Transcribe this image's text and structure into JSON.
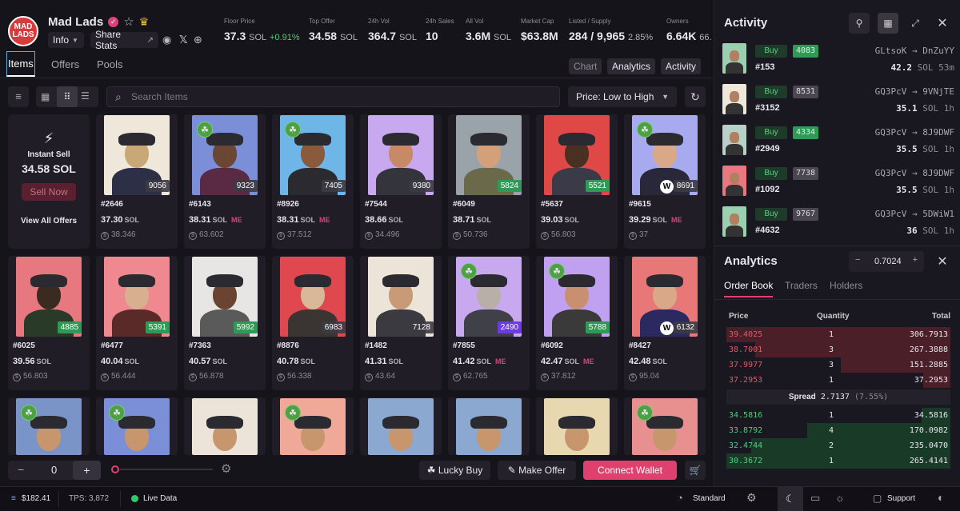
{
  "header": {
    "collection_name": "Mad Lads",
    "logo_text": "MAD LADS",
    "info_label": "Info",
    "share_stats_label": "Share Stats"
  },
  "stats": [
    {
      "label": "Floor Price",
      "value": "37.3",
      "unit": "SOL",
      "change": "+0.91%"
    },
    {
      "label": "Top Offer",
      "value": "34.58",
      "unit": "SOL",
      "change": ""
    },
    {
      "label": "24h Vol",
      "value": "364.7",
      "unit": "SOL",
      "change": ""
    },
    {
      "label": "24h Sales",
      "value": "10",
      "unit": "",
      "change": ""
    },
    {
      "label": "All Vol",
      "value": "3.6M",
      "unit": "SOL",
      "change": ""
    },
    {
      "label": "Market Cap",
      "value": "$63.8M",
      "unit": "",
      "change": ""
    },
    {
      "label": "Listed / Supply",
      "value": "284 / 9,965",
      "unit": "",
      "change": "2.85%"
    },
    {
      "label": "Owners",
      "value": "6.64K",
      "unit": "66.",
      "change": ""
    }
  ],
  "tabs": {
    "items": "Items",
    "offers": "Offers",
    "pools": "Pools",
    "chart": "Chart",
    "analytics": "Analytics",
    "activity": "Activity"
  },
  "toolbar": {
    "search_placeholder": "Search Items",
    "sort_label": "Price: Low to High"
  },
  "instant_sell": {
    "title": "Instant Sell",
    "price": "34.58 SOL",
    "sell_now": "Sell Now",
    "view_all": "View All Offers"
  },
  "cards": [
    {
      "name": "#2646",
      "price": "37.30",
      "last": "38.346",
      "rank": "9056",
      "me": false,
      "clover": false
    },
    {
      "name": "#6143",
      "price": "38.31",
      "last": "63.602",
      "rank": "9323",
      "me": true,
      "clover": true
    },
    {
      "name": "#8926",
      "price": "38.31",
      "last": "37.512",
      "rank": "7405",
      "me": true,
      "clover": true
    },
    {
      "name": "#7544",
      "price": "38.66",
      "last": "34.496",
      "rank": "9380",
      "me": false,
      "clover": false
    },
    {
      "name": "#6049",
      "price": "38.71",
      "last": "50.736",
      "rank": "5824",
      "me": false,
      "clover": false
    },
    {
      "name": "#5637",
      "price": "39.03",
      "last": "56.803",
      "rank": "5521",
      "me": false,
      "clover": false
    },
    {
      "name": "#9615",
      "price": "39.29",
      "last": "37",
      "rank": "8691",
      "me": true,
      "clover": true
    },
    {
      "name": "#6025",
      "price": "39.56",
      "last": "56.803",
      "rank": "4885",
      "me": false,
      "clover": false
    },
    {
      "name": "#6477",
      "price": "40.04",
      "last": "56.444",
      "rank": "5391",
      "me": false,
      "clover": false
    },
    {
      "name": "#7363",
      "price": "40.57",
      "last": "56.878",
      "rank": "5992",
      "me": false,
      "clover": false
    },
    {
      "name": "#8876",
      "price": "40.78",
      "last": "56.338",
      "rank": "6983",
      "me": false,
      "clover": false
    },
    {
      "name": "#1482",
      "price": "41.31",
      "last": "43.64",
      "rank": "7128",
      "me": false,
      "clover": false
    },
    {
      "name": "#7855",
      "price": "41.42",
      "last": "62.765",
      "rank": "2490",
      "me": true,
      "clover": true
    },
    {
      "name": "#6092",
      "price": "42.47",
      "last": "37.812",
      "rank": "5788",
      "me": true,
      "clover": true
    },
    {
      "name": "#8427",
      "price": "42.48",
      "last": "95.04",
      "rank": "6132",
      "me": false,
      "clover": false
    }
  ],
  "card_unit": "SOL",
  "me_mark": "ME",
  "bottom": {
    "quantity": "0",
    "lucky_buy": "Lucky Buy",
    "make_offer": "Make Offer",
    "connect_wallet": "Connect Wallet"
  },
  "activity": {
    "title": "Activity",
    "rows": [
      {
        "type": "Buy",
        "rank": "4083",
        "num": "#153",
        "from": "GLtsoK",
        "to": "DnZuYY",
        "price": "42.2",
        "unit": "SOL",
        "time": "53m"
      },
      {
        "type": "Buy",
        "rank": "8531",
        "num": "#3152",
        "from": "GQ3PcV",
        "to": "9VNjTE",
        "price": "35.1",
        "unit": "SOL",
        "time": "1h"
      },
      {
        "type": "Buy",
        "rank": "4334",
        "num": "#2949",
        "from": "GQ3PcV",
        "to": "8J9DWF",
        "price": "35.5",
        "unit": "SOL",
        "time": "1h"
      },
      {
        "type": "Buy",
        "rank": "7738",
        "num": "#1092",
        "from": "GQ3PcV",
        "to": "8J9DWF",
        "price": "35.5",
        "unit": "SOL",
        "time": "1h"
      },
      {
        "type": "Buy",
        "rank": "9767",
        "num": "#4632",
        "from": "GQ3PcV",
        "to": "5DWiW1",
        "price": "36",
        "unit": "SOL",
        "time": "1h"
      }
    ]
  },
  "analytics": {
    "title": "Analytics",
    "step_value": "0.7024",
    "tabs": [
      "Order Book",
      "Traders",
      "Holders"
    ],
    "headers": {
      "price": "Price",
      "quantity": "Quantity",
      "total": "Total"
    },
    "asks": [
      {
        "price": "39.4025",
        "qty": "1",
        "total": "306.7913",
        "fill": 1.0
      },
      {
        "price": "38.7001",
        "qty": "3",
        "total": "267.3888",
        "fill": 0.87
      },
      {
        "price": "37.9977",
        "qty": "3",
        "total": "151.2885",
        "fill": 0.49
      },
      {
        "price": "37.2953",
        "qty": "1",
        "total": "37.2953",
        "fill": 0.12
      }
    ],
    "spread_label": "Spread",
    "spread_value": "2.7137",
    "spread_pct": "(7.55%)",
    "bids": [
      {
        "price": "34.5816",
        "qty": "1",
        "total": "34.5816",
        "fill": 0.13
      },
      {
        "price": "33.8792",
        "qty": "4",
        "total": "170.0982",
        "fill": 0.64
      },
      {
        "price": "32.4744",
        "qty": "2",
        "total": "235.0470",
        "fill": 0.89
      },
      {
        "price": "30.3672",
        "qty": "1",
        "total": "265.4141",
        "fill": 1.0
      }
    ]
  },
  "status": {
    "sol_price": "$182.41",
    "tps": "TPS: 3,872",
    "live": "Live Data",
    "mode": "Standard",
    "support": "Support"
  },
  "colors": {
    "accent_pink": "#e0406e",
    "green": "#4cd07d",
    "red": "#e05a6a"
  }
}
